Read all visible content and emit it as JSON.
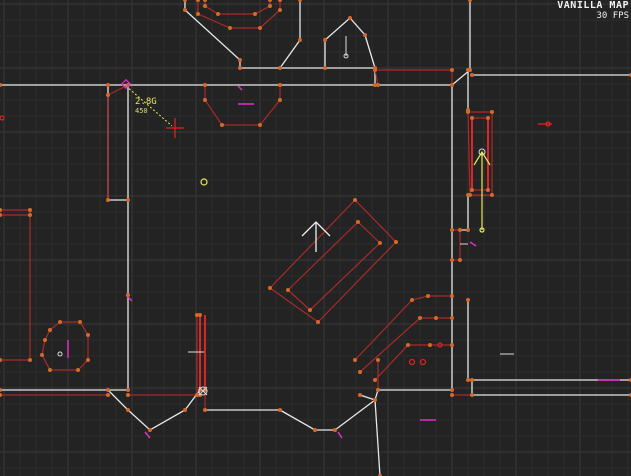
{
  "hud": {
    "map_name": "VANILLA MAP",
    "fps": "30 FPS"
  },
  "measure": {
    "length": "2.8G",
    "angle": "450"
  },
  "colors": {
    "background": "#232323",
    "grid_minor": "#2c2c2c",
    "grid_major": "#3a3a3a",
    "wall_solid": "#e8e8e8",
    "wall_sector": "#a82a2a",
    "vertex": "#d36a2a",
    "thing": "#e030c8",
    "selection": "#e8e85a",
    "highlight": "#ff2a2a"
  },
  "icons": {
    "player_start": "arrow-up-icon",
    "cursor": "crosshair-icon",
    "thing_marker": "thing-icon",
    "vertex_marker": "vertex-icon"
  }
}
